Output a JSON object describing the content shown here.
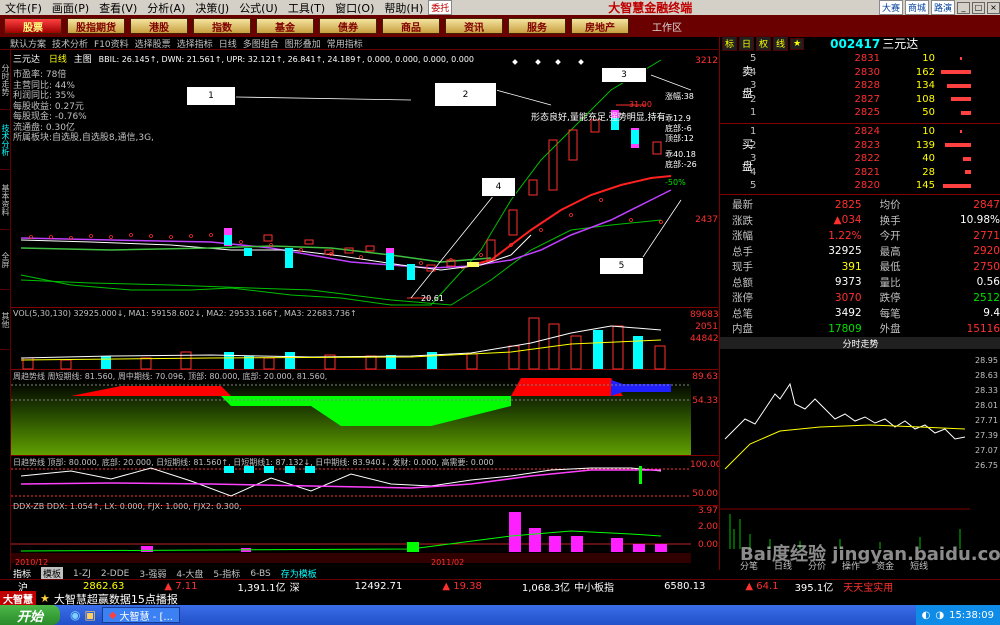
{
  "menu": [
    "文件(F)",
    "画面(P)",
    "查看(V)",
    "分析(A)",
    "决策(J)",
    "公式(U)",
    "工具(T)",
    "窗口(O)",
    "帮助(H)"
  ],
  "menu_badge": "委托",
  "app_title": "大智慧金融终端",
  "mini_buttons": [
    "大赛",
    "商城",
    "路演"
  ],
  "toolbar": [
    "股票",
    "股指期货",
    "港股",
    "指数",
    "基金",
    "债券",
    "商品",
    "资讯",
    "服务",
    "房地产"
  ],
  "workarea": "工作区",
  "toolbar2": [
    "默认方案",
    "技术分析",
    "F10资料",
    "选择股票",
    "选择指标",
    "日线",
    "多图组合",
    "图形叠加",
    "常用指标"
  ],
  "left_tabs": [
    "分时走势",
    "技术分析",
    "基本资料",
    "全屏",
    "其他"
  ],
  "kline": {
    "header_name": "三元达",
    "header_period": "日线",
    "header_mode": "主图",
    "header_ind": "BBIL: 26.145↑, DWN: 21.561↑, UPR: 32.121↑, 26.841↑, 24.189↑, 0.000, 0.000, 0.000, 0.000",
    "info": [
      "市盈率:   78倍",
      "主营同比:  44%",
      "利润同比:  35%",
      "每股收益:  0.27元",
      "每股现金: -0.76%",
      "流通盘:   0.30亿",
      "所属板块:自选股,自选股8,通信,3G,"
    ],
    "annotation": "形态良好,量能充足,强势明显,持有",
    "boxes": [
      "1",
      "2",
      "3",
      "4",
      "5"
    ],
    "low_label": "20.61",
    "high_label": "31.00",
    "right_labels": [
      "涨幅:38",
      "乖12.9",
      "底部:-6",
      "顶部:12",
      "乖40.18",
      "底部:-26",
      "-50%"
    ],
    "axis": [
      "3212",
      "2437",
      "2051"
    ]
  },
  "vol": {
    "header": "VOL(5,30,130)  32925.000↓, MA1: 59158.602↓, MA2: 29533.166↑, MA3: 22683.736↑",
    "axis": [
      "89683",
      "44842"
    ]
  },
  "weekly": {
    "header": "周趋势线  周短期线: 81.560, 周中期线: 70.096, 顶部: 80.000, 底部: 20.000, 81.560,",
    "axis": [
      "89.63",
      "54.33"
    ]
  },
  "daily": {
    "header": "日趋势线  顶部: 80.000, 底部: 20.000, 日短期线: 81.560↑, 日短期线1: 87.132↓, 日中期线: 83.940↓, 发财: 0.000, 高需要: 0.000",
    "axis": [
      "100.00",
      "50.00"
    ]
  },
  "ddx": {
    "header": "DDX-ZB DDX: 1.054↑, LX: 0.000, FJX: 1.000, FJX2: 0.300,",
    "axis": [
      "3.97",
      "2.00",
      "0.00"
    ]
  },
  "date_labels": [
    "2010/12",
    "2011/02"
  ],
  "bottom_tabs": [
    "指标",
    "模板",
    "1-ZJ",
    "2-DDE",
    "3-强弱",
    "4-大盘",
    "5-指标",
    "6-BS",
    "存为模板"
  ],
  "right": {
    "tabs": [
      "标",
      "日",
      "权",
      "线",
      "★"
    ],
    "code": "002417",
    "name": "三元达",
    "sell_label": "卖盘",
    "buy_label": "买盘",
    "asks": [
      {
        "lvl": "5",
        "price": "2831",
        "vol": "10"
      },
      {
        "lvl": "4",
        "price": "2830",
        "vol": "162"
      },
      {
        "lvl": "3",
        "price": "2828",
        "vol": "134"
      },
      {
        "lvl": "2",
        "price": "2827",
        "vol": "108"
      },
      {
        "lvl": "1",
        "price": "2825",
        "vol": "50"
      }
    ],
    "bids": [
      {
        "lvl": "1",
        "price": "2824",
        "vol": "10"
      },
      {
        "lvl": "2",
        "price": "2823",
        "vol": "139"
      },
      {
        "lvl": "3",
        "price": "2822",
        "vol": "40"
      },
      {
        "lvl": "4",
        "price": "2821",
        "vol": "28"
      },
      {
        "lvl": "5",
        "price": "2820",
        "vol": "145"
      }
    ],
    "quotes": [
      [
        "最新",
        "2825",
        "均价",
        "2847"
      ],
      [
        "涨跌",
        "▲034",
        "换手",
        "10.98%"
      ],
      [
        "涨幅",
        "1.22%",
        "今开",
        "2771"
      ],
      [
        "总手",
        "32925",
        "最高",
        "2920"
      ],
      [
        "现手",
        "391",
        "最低",
        "2750"
      ],
      [
        "总额",
        "9373",
        "量比",
        "0.56"
      ],
      [
        "涨停",
        "3070",
        "跌停",
        "2512"
      ],
      [
        "总笔",
        "3492",
        "每笔",
        "9.4"
      ],
      [
        "内盘",
        "17809",
        "外盘",
        "15116"
      ]
    ],
    "mini_title": "分时走势",
    "mini_axis": [
      "28.95",
      "28.63",
      "28.33",
      "28.01",
      "27.71",
      "27.39",
      "27.07",
      "26.75"
    ],
    "mini_tabs": [
      "分笔",
      "日线",
      "分价",
      "操作",
      "资金",
      "短线"
    ]
  },
  "indexbar": {
    "hu_label": "沪",
    "hu_value": "2862.63",
    "hu_change": "▲ 7.11",
    "hu_amount": "1,391.1亿",
    "shen_label": "深",
    "shen_value": "12492.71",
    "shen_change": "▲ 19.38",
    "shen_amount": "1,068.3亿",
    "small_label": "中小板指",
    "small_value": "6580.13",
    "right_change": "▲ 64.1",
    "right_amount": "395.1亿",
    "right_note": "天天宝实用"
  },
  "ticker": {
    "brand": "大智慧",
    "text": "大智慧超赢数据15点播报"
  },
  "taskbar": {
    "start": "开始",
    "item": "大智慧 - [...",
    "time": "15:38:09"
  },
  "watermark": "Bai度经验  jingyan.baidu.com"
}
